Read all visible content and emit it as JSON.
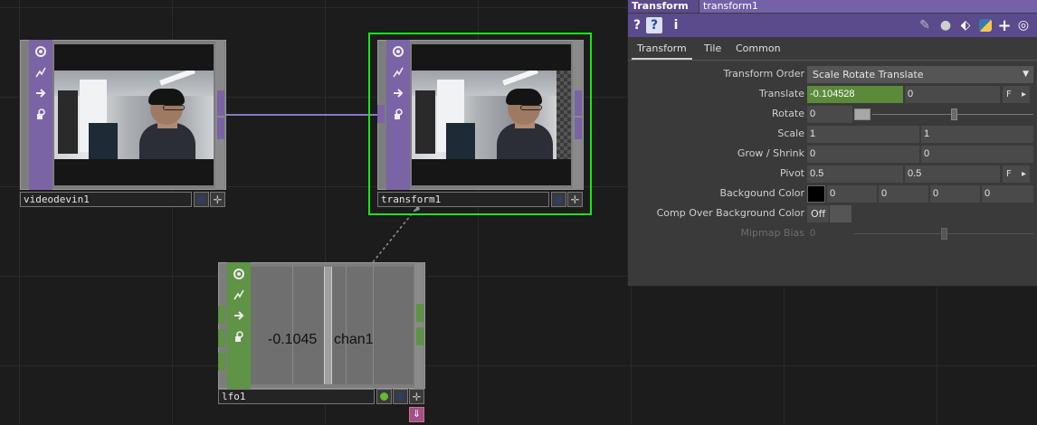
{
  "network": {
    "nodes": {
      "videodevin": {
        "name": "videodevin1",
        "family": "TOP"
      },
      "transform": {
        "name": "transform1",
        "family": "TOP",
        "selected": true
      },
      "lfo": {
        "name": "lfo1",
        "family": "CHOP",
        "channel_value": "-0.1045",
        "channel_name": "chan1"
      }
    },
    "colors": {
      "top": "#7a64a6",
      "chop": "#5f9346",
      "selection": "#19e619"
    }
  },
  "panel": {
    "op_type": "Transform",
    "op_name": "transform1",
    "toolbar_icons": [
      "help-icon",
      "python-help-icon",
      "info-icon",
      "edit-icon",
      "comment-icon",
      "tag-icon",
      "python-icon",
      "add-icon",
      "viewer-icon"
    ],
    "tabs": [
      "Transform",
      "Tile",
      "Common"
    ],
    "active_tab": "Transform",
    "params": {
      "transform_order": {
        "label": "Transform Order",
        "value": "Scale Rotate Translate"
      },
      "translate": {
        "label": "Translate",
        "x": "-0.104528",
        "y": "0",
        "mode": "F"
      },
      "rotate": {
        "label": "Rotate",
        "value": "0"
      },
      "scale": {
        "label": "Scale",
        "x": "1",
        "y": "1"
      },
      "grow": {
        "label": "Grow / Shrink",
        "x": "0",
        "y": "0"
      },
      "pivot": {
        "label": "Pivot",
        "x": "0.5",
        "y": "0.5",
        "mode": "F"
      },
      "bg_color": {
        "label": "Backgound Color",
        "r": "0",
        "g": "0",
        "b": "0",
        "a": "0",
        "swatch": "#000000"
      },
      "comp_over": {
        "label": "Comp Over Background Color",
        "value": "Off"
      },
      "mipmap": {
        "label": "Mipmap Bias",
        "value": "0"
      }
    }
  }
}
